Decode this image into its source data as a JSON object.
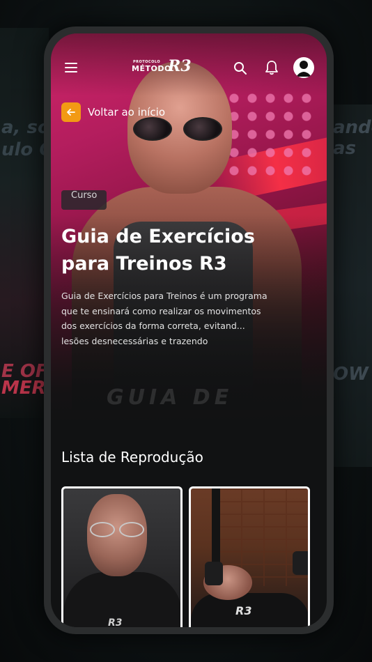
{
  "header": {
    "logo_small": "PROTOCOLO",
    "logo_main": "MÉTODO",
    "logo_r3": "R3"
  },
  "hero": {
    "back_label": "Voltar ao início",
    "badge": "Curso",
    "title": "Guia de Exercícios para Treinos R3",
    "description": "Guia de Exercícios para Treinos é um programa que te ensinará como realizar os movimentos dos exercícios da forma correta, evitand... lesões desnecessárias e trazendo",
    "watermark": "GUIA DE"
  },
  "playlist": {
    "heading": "Lista de Reprodução",
    "cards": [
      {
        "mark": "R3"
      },
      {
        "mark": "R3"
      }
    ]
  },
  "background": {
    "left_text_1": "a, sou",
    "left_text_2": "ulo Co",
    "left_text_3": "E OF",
    "left_text_4": "MER",
    "right_text_1": "ando",
    "right_text_2": "as",
    "right_text_3": "OW"
  },
  "colors": {
    "accent": "#f29a14",
    "hero_magenta": "#c21f64",
    "screen_bg": "#111213"
  }
}
